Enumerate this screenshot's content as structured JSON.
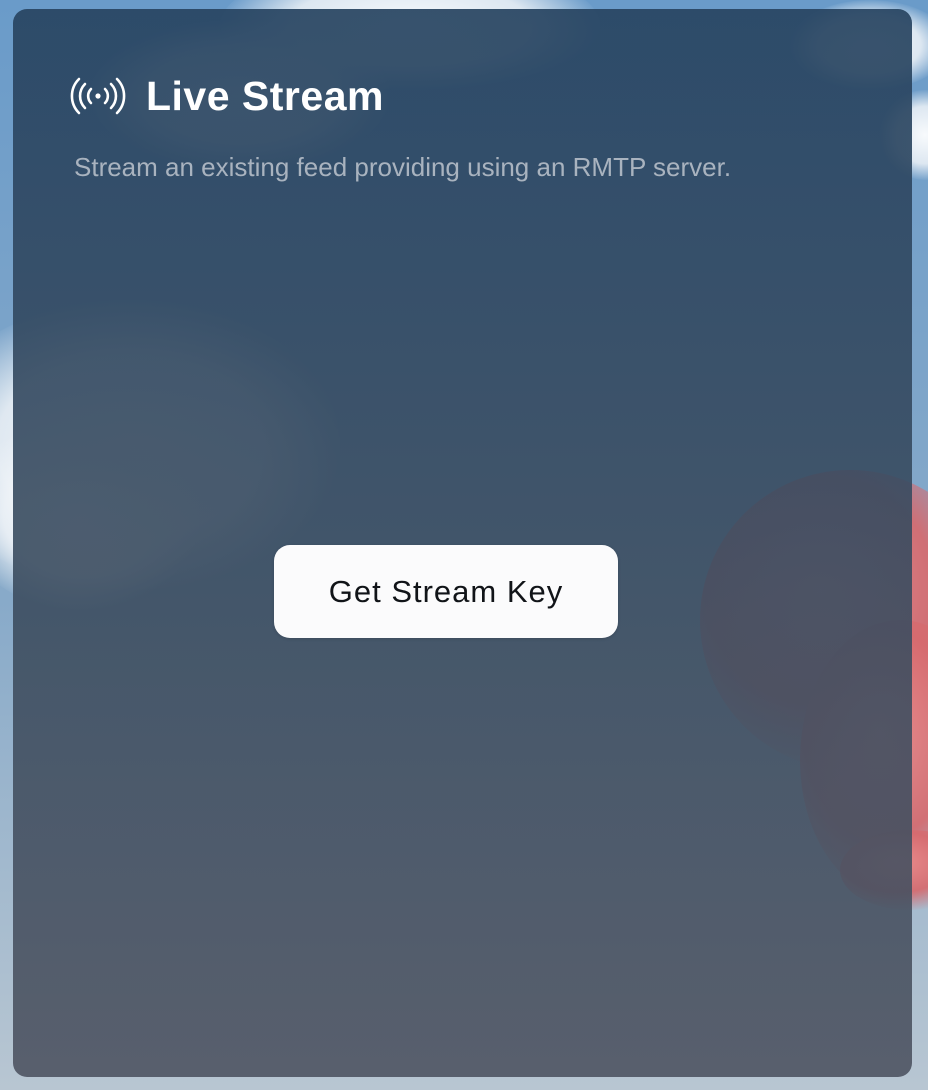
{
  "live_stream_card": {
    "icon": "broadcast-signal-icon",
    "title": "Live Stream",
    "subtitle": "Stream an existing feed providing using an RMTP server.",
    "get_stream_key_label": "Get Stream Key"
  },
  "colors": {
    "card_overlay": "#2b4763",
    "title": "#ffffff",
    "subtitle": "#a9b3bf",
    "button_bg": "#fbfbfc",
    "button_text": "#111418"
  }
}
